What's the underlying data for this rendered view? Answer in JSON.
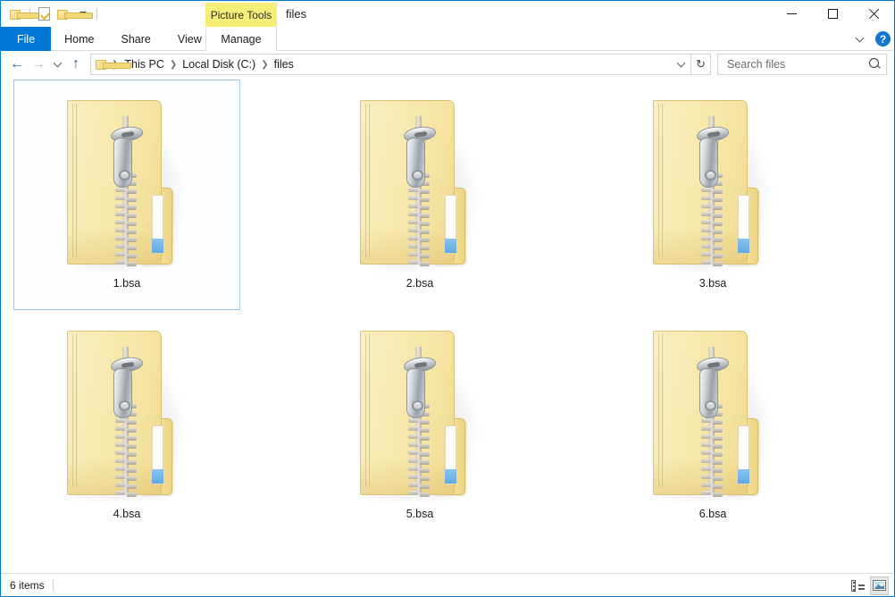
{
  "window": {
    "title": "files",
    "border_color": "#0078d7",
    "controls": {
      "minimize": "—",
      "maximize": "□",
      "close": "✕"
    }
  },
  "quick_access_toolbar": {
    "items": [
      {
        "name": "folder-icon",
        "label": ""
      },
      {
        "name": "properties-icon",
        "label": ""
      },
      {
        "name": "new-folder-icon",
        "label": ""
      },
      {
        "name": "customize-dropdown-icon",
        "label": ""
      }
    ]
  },
  "ribbon": {
    "contextual_banner": "Picture Tools",
    "contextual_banner_color": "#f5ef77",
    "tabs": [
      {
        "label": "File",
        "active": true,
        "accent": "#0078d7"
      },
      {
        "label": "Home",
        "active": false
      },
      {
        "label": "Share",
        "active": false
      },
      {
        "label": "View",
        "active": false
      },
      {
        "label": "Manage",
        "active": false,
        "contextual": true
      }
    ],
    "collapse_icon": "chevron-down-icon",
    "help_label": "?"
  },
  "address_bar": {
    "back_label": "←",
    "forward_label": "→",
    "history_label": "⌄",
    "up_label": "↑",
    "breadcrumb_icon": "folder-icon",
    "breadcrumbs": [
      "This PC",
      "Local Disk (C:)",
      "files"
    ],
    "separator": "❯",
    "dropdown_icon": "chevron-down-icon",
    "refresh_label": "↻"
  },
  "search": {
    "placeholder": "Search files",
    "value": "",
    "icon": "search-icon"
  },
  "file_list": {
    "view": "large-icons",
    "columns": 3,
    "items": [
      {
        "name": "1.bsa",
        "icon": "zipped-folder-icon",
        "selected": true
      },
      {
        "name": "2.bsa",
        "icon": "zipped-folder-icon",
        "selected": false
      },
      {
        "name": "3.bsa",
        "icon": "zipped-folder-icon",
        "selected": false
      },
      {
        "name": "4.bsa",
        "icon": "zipped-folder-icon",
        "selected": false
      },
      {
        "name": "5.bsa",
        "icon": "zipped-folder-icon",
        "selected": false
      },
      {
        "name": "6.bsa",
        "icon": "zipped-folder-icon",
        "selected": false
      }
    ],
    "selection_border_color": "#9cc9ef",
    "folder_color": "#f8e9b0",
    "tab_label_color": "#ffffff",
    "tab_accent_color": "#5fa9e4"
  },
  "status_bar": {
    "item_count": "6 items",
    "view_buttons": [
      {
        "name": "details-view-button",
        "icon": "details-view-icon",
        "active": false
      },
      {
        "name": "large-icons-view-button",
        "icon": "large-icons-view-icon",
        "active": true
      }
    ]
  }
}
